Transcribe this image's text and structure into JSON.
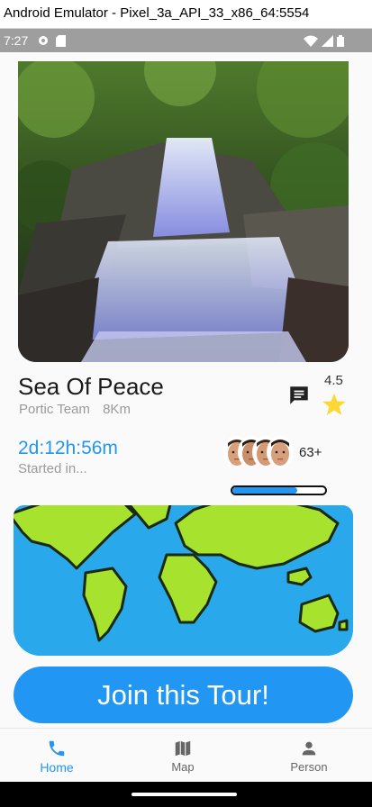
{
  "window": {
    "title": "Android Emulator - Pixel_3a_API_33_x86_64:5554"
  },
  "status_bar": {
    "time": "7:27"
  },
  "tour": {
    "name": "Sea Of Peace",
    "team": "Portic Team",
    "distance": "8Km",
    "rating": "4.5",
    "countdown": "2d:12h:56m",
    "countdown_caption": "Started in...",
    "participants_more": "63+",
    "progress_fraction": 0.7
  },
  "actions": {
    "join_label": "Join this Tour!"
  },
  "bottom_nav": {
    "items": [
      {
        "label": "Home",
        "icon": "phone-icon",
        "active": true
      },
      {
        "label": "Map",
        "icon": "map-icon",
        "active": false
      },
      {
        "label": "Person",
        "icon": "person-icon",
        "active": false
      }
    ]
  },
  "colors": {
    "accent": "#2196f3",
    "star": "#fdd835",
    "map_land": "#a6e22e",
    "map_water": "#29a9ec"
  }
}
